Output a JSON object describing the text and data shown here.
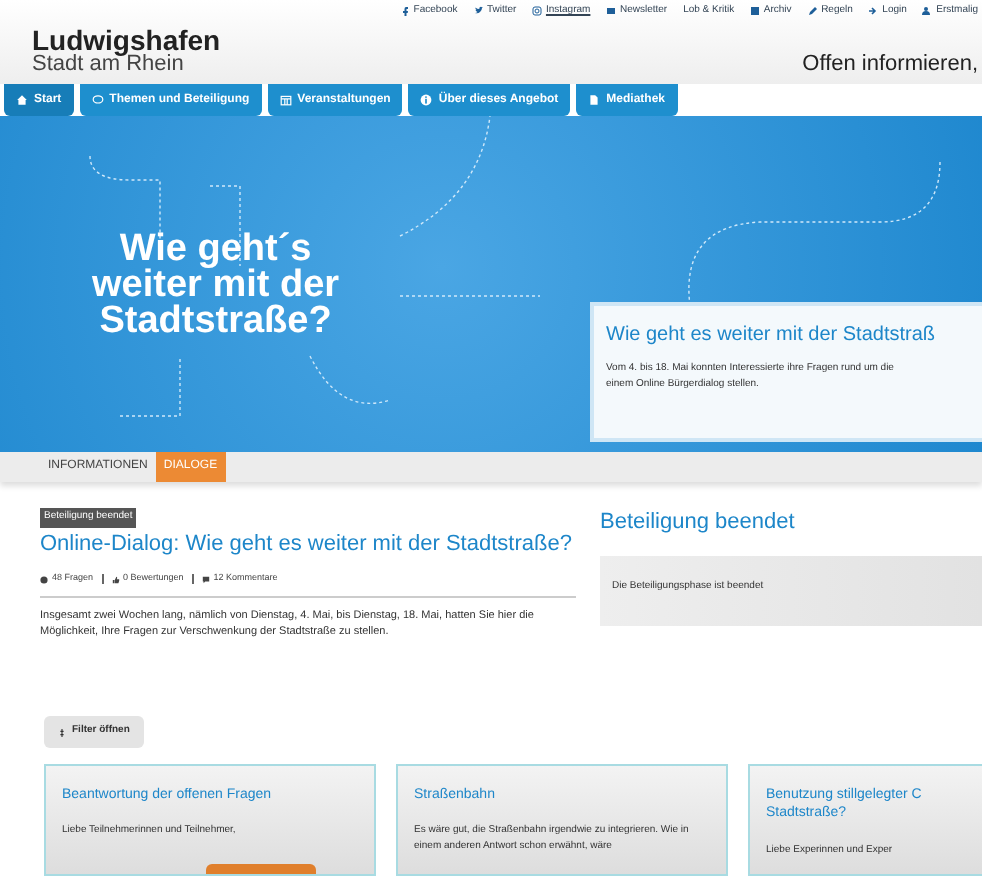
{
  "top_links": [
    "Facebook",
    "Twitter",
    "Instagram",
    "Newsletter",
    "Lob & Kritik",
    "Archiv",
    "Regeln",
    "Login",
    "Erstmalig"
  ],
  "logo": {
    "name": "Ludwigshafen",
    "subtitle": "Stadt am Rhein"
  },
  "slogan": "Offen informieren,",
  "nav": [
    {
      "label": "Start",
      "selected": true
    },
    {
      "label": "Themen und Beteiligung",
      "selected": false
    },
    {
      "label": "Veranstaltungen",
      "selected": false
    },
    {
      "label": "Über dieses Angebot",
      "selected": false
    },
    {
      "label": "Mediathek",
      "selected": false
    }
  ],
  "hero": {
    "headline": [
      "Wie geht´s",
      "weiter mit der",
      "Stadtstraße?"
    ],
    "panel_title": "Wie geht es weiter mit der Stadtstraß",
    "panel_lines": [
      "Vom 4. bis 18. Mai konnten Interessierte ihre Fragen rund um die",
      "einem Online Bürgerdialog stellen."
    ]
  },
  "tabs": [
    {
      "label": "INFORMATIONEN",
      "selected": false
    },
    {
      "label": "DIALOGE",
      "selected": true
    }
  ],
  "dialog": {
    "badge": "Beteiligung beendet",
    "title": "Online-Dialog: Wie geht es weiter mit der Stadtstraße?",
    "stats": [
      "48 Fragen",
      "0 Bewertungen",
      "12 Kommentare"
    ],
    "text": "Insgesamt zwei Wochen lang, nämlich von Dienstag, 4. Mai, bis Dienstag, 18. Mai, hatten Sie hier die Möglichkeit, Ihre Fragen zur Verschwenkung der Stadtstraße zu stellen."
  },
  "status": {
    "title": "Beteiligung beendet",
    "message": "Die Beteiligungsphase ist beendet"
  },
  "filter_button": "Filter öffnen",
  "cards": [
    {
      "title_lines": [
        "Beantwortung der offenen Fragen"
      ],
      "text": "Liebe Teilnehmerinnen und Teilnehmer,",
      "kind": "with_button"
    },
    {
      "title_lines": [
        "Straßenbahn"
      ],
      "text": "Es wäre gut, die Straßenbahn irgendwie zu integrieren. Wie in einem anderen Antwort schon erwähnt, wäre",
      "kind": "plain"
    },
    {
      "title_lines": [
        "Benutzung stillgelegter C",
        "Stadtstraße?"
      ],
      "text": "Liebe Experinnen und Exper",
      "kind": "plain"
    }
  ]
}
